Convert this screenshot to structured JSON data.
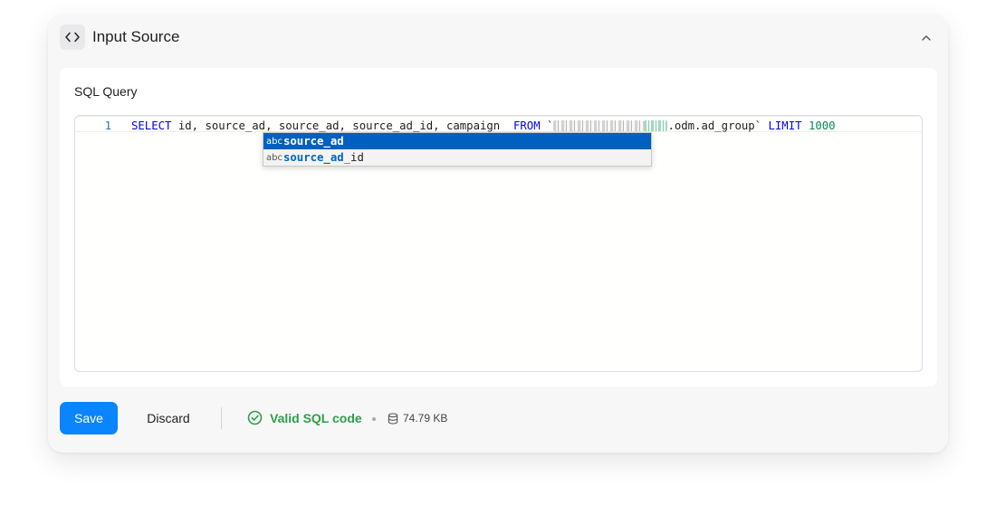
{
  "panel": {
    "title": "Input Source"
  },
  "card": {
    "label": "SQL Query"
  },
  "editor": {
    "line_number": "1",
    "tokens": {
      "select": "SELECT",
      "columns": " id, source_ad, source_ad, source_ad_id, campaign  ",
      "from": "FROM",
      "table_prefix": " `",
      "table_suffix": ".odm.ad_group` ",
      "limit": "LIMIT",
      "limit_value": "1000"
    },
    "suggestions": [
      {
        "kind": "abc",
        "match": "source_ad",
        "rest": ""
      },
      {
        "kind": "abc",
        "match": "source_ad",
        "rest": "_id"
      }
    ]
  },
  "footer": {
    "save_label": "Save",
    "discard_label": "Discard",
    "status_text": "Valid SQL code",
    "size_text": "74.79 KB"
  },
  "colors": {
    "primary": "#0a84ff",
    "success": "#2e9e4a",
    "keyword": "#0000ff",
    "number": "#098658",
    "suggest_selected": "#0060c0"
  }
}
